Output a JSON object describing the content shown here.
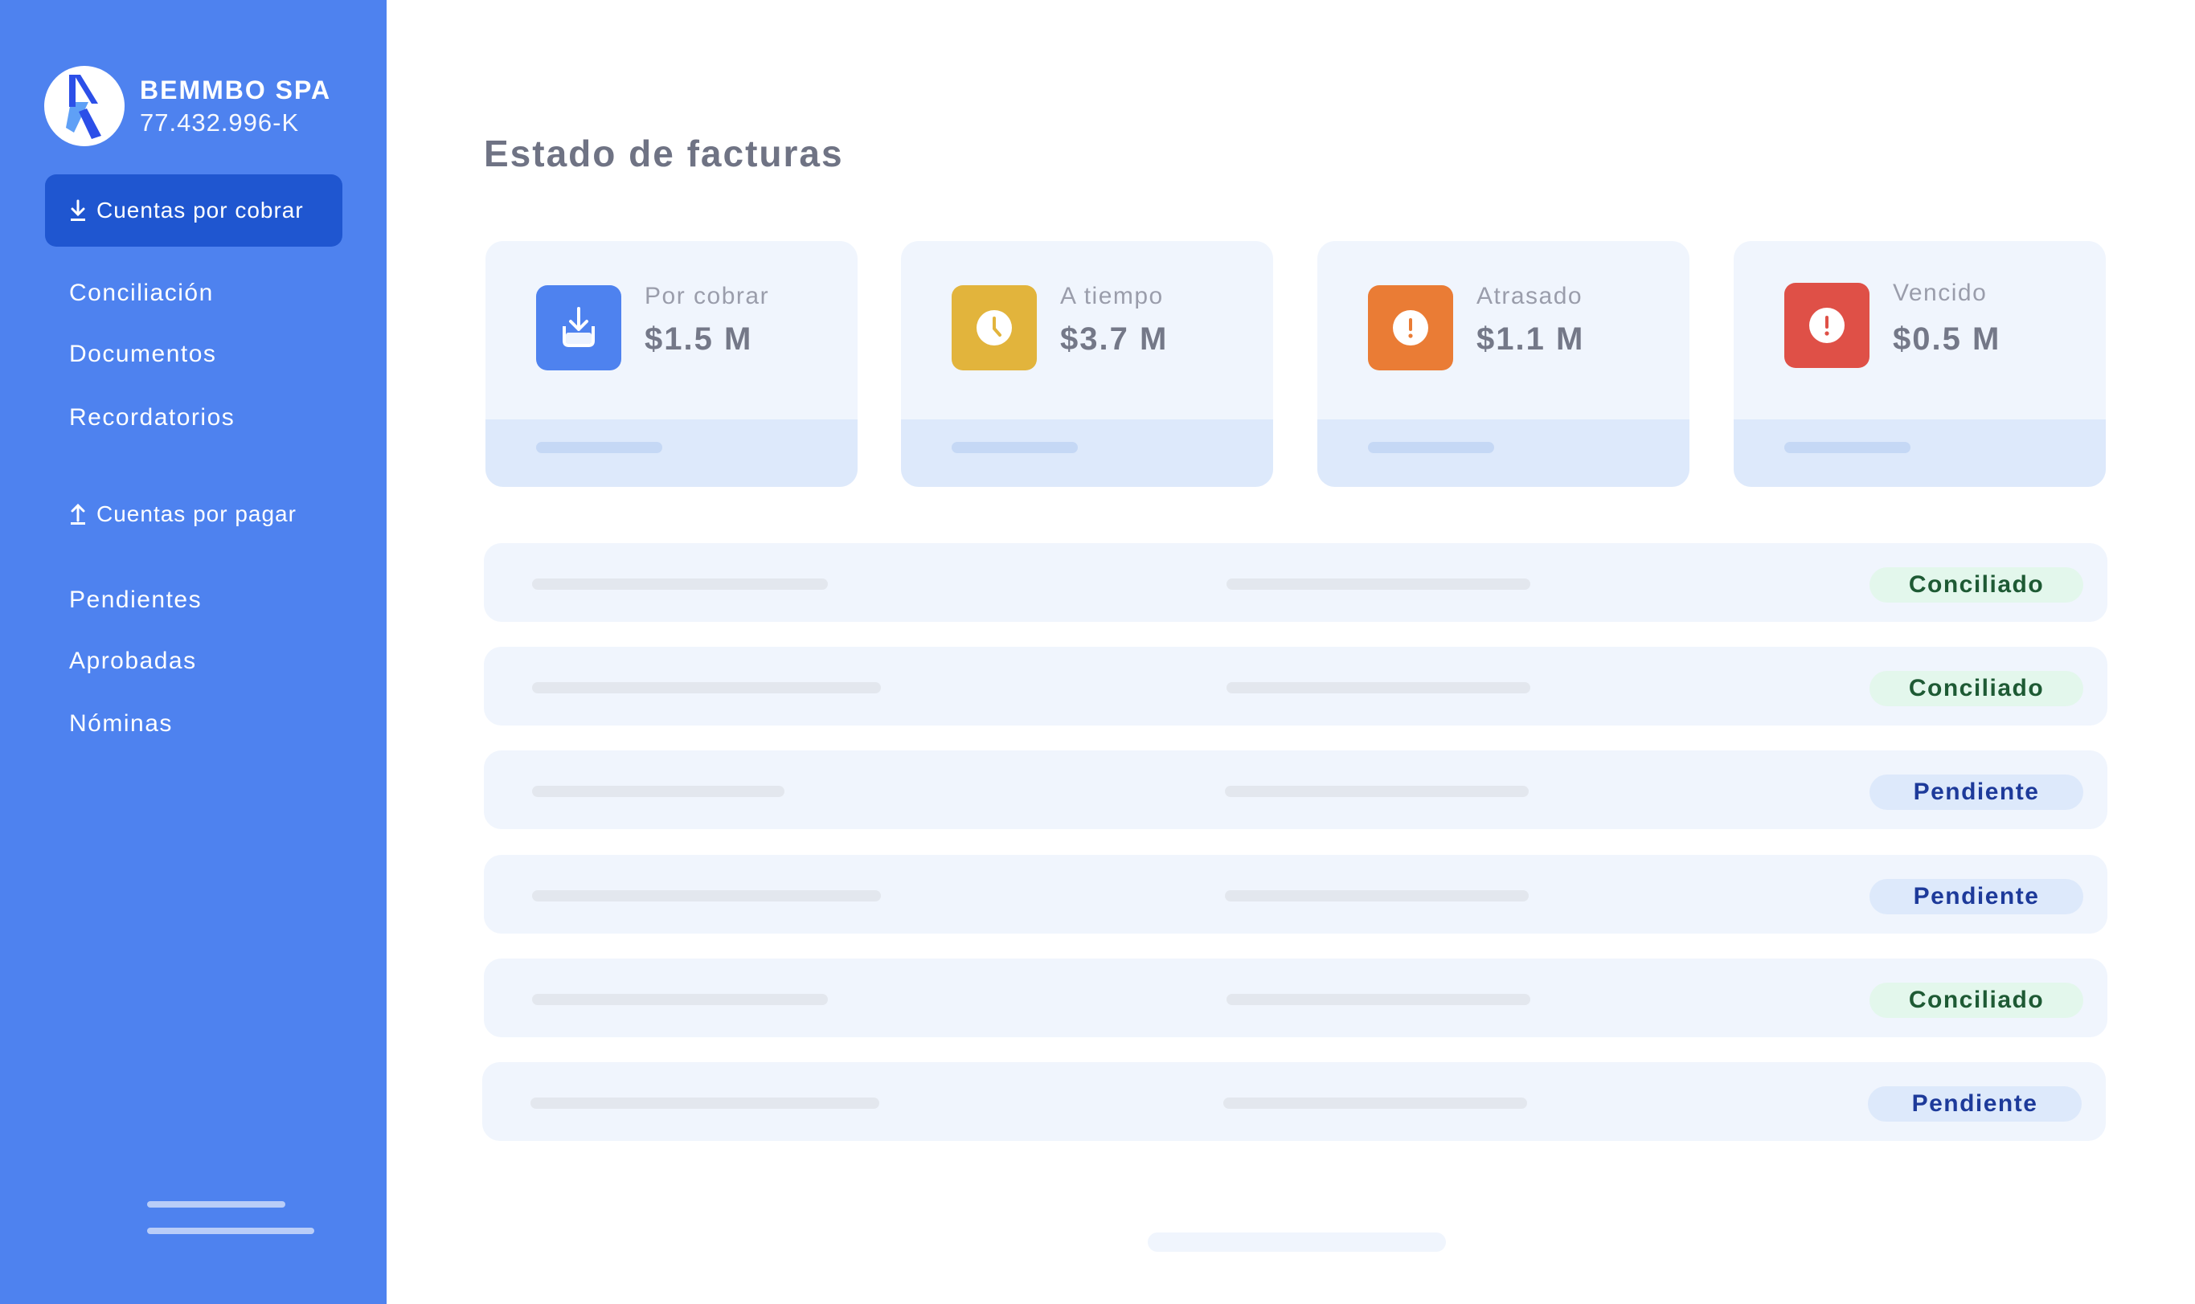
{
  "company": {
    "name": "BEMMBO SPA",
    "rut": "77.432.996-K"
  },
  "nav": {
    "receivables_label": "Cuentas por cobrar",
    "receivables_items": [
      "Conciliación",
      "Documentos",
      "Recordatorios"
    ],
    "payables_label": "Cuentas por pagar",
    "payables_items": [
      "Pendientes",
      "Aprobadas",
      "Nóminas"
    ]
  },
  "main": {
    "title": "Estado de facturas",
    "cards": [
      {
        "label": "Por cobrar",
        "value": "$1.5 M",
        "color": "#4e82ef",
        "icon": "download-tray-icon"
      },
      {
        "label": "A tiempo",
        "value": "$3.7 M",
        "color": "#e2b43c",
        "icon": "clock-icon"
      },
      {
        "label": "Atrasado",
        "value": "$1.1 M",
        "color": "#ea7c35",
        "icon": "alert-icon"
      },
      {
        "label": "Vencido",
        "value": "$0.5 M",
        "color": "#df5047",
        "icon": "alert-icon"
      }
    ],
    "rows": [
      {
        "status": "Conciliado",
        "type": "ok"
      },
      {
        "status": "Conciliado",
        "type": "ok"
      },
      {
        "status": "Pendiente",
        "type": "pend"
      },
      {
        "status": "Pendiente",
        "type": "pend"
      },
      {
        "status": "Conciliado",
        "type": "ok"
      },
      {
        "status": "Pendiente",
        "type": "pend"
      }
    ]
  }
}
